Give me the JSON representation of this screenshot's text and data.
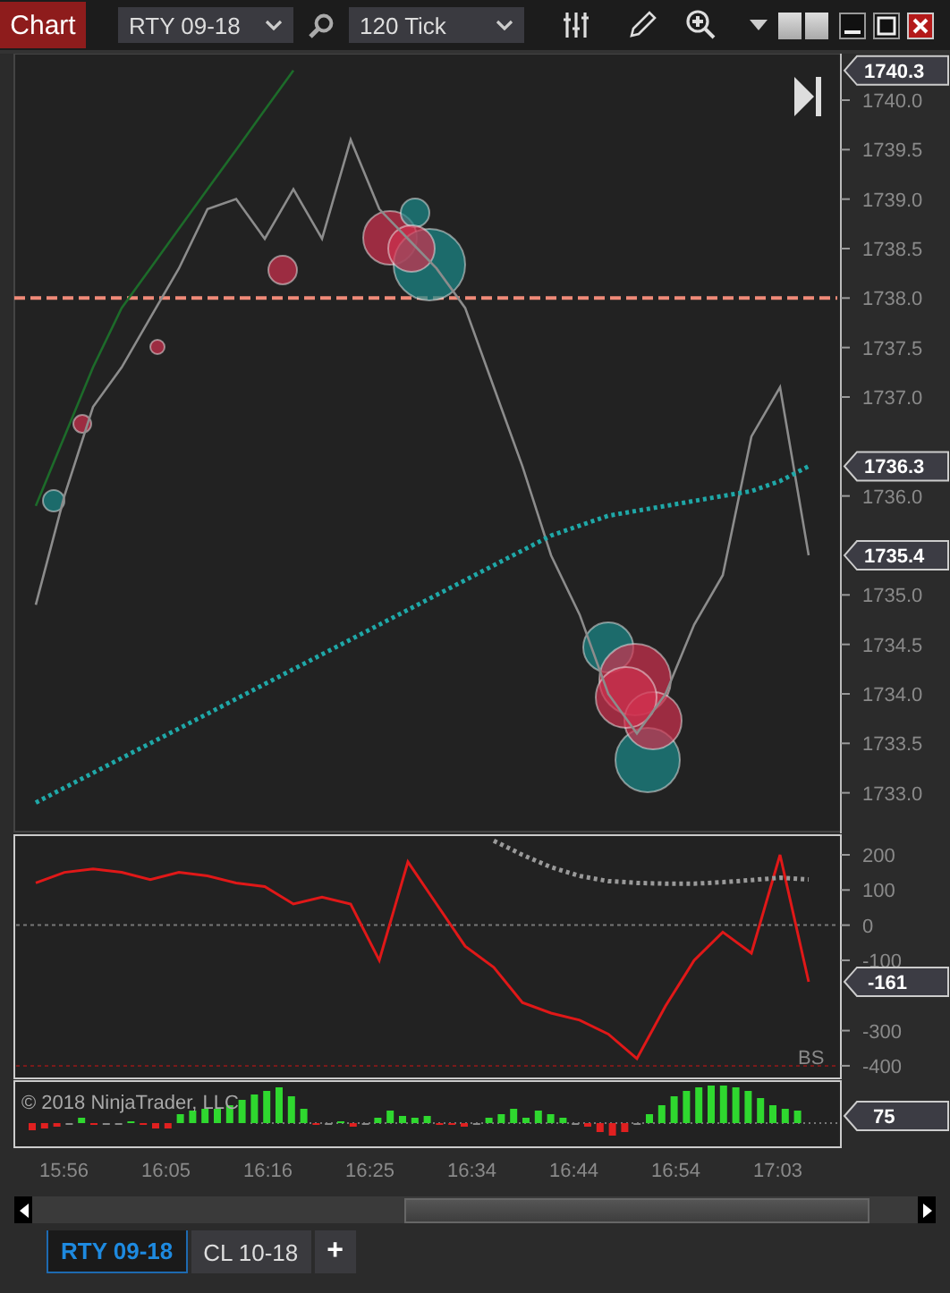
{
  "toolbar": {
    "title": "Chart",
    "instrument": "RTY 09-18",
    "interval": "120 Tick"
  },
  "price_panel": {
    "chart_data": {
      "type": "line",
      "ylim": [
        1732.59,
        1740.47
      ],
      "yticks": [
        {
          "value": 1733,
          "label": "1733.0"
        },
        {
          "value": 1733.5,
          "label": "1733.5"
        },
        {
          "value": 1734,
          "label": "1734.0"
        },
        {
          "value": 1734.5,
          "label": "1734.5"
        },
        {
          "value": 1735,
          "label": "1735.0"
        },
        {
          "value": 1736,
          "label": "1736.0"
        },
        {
          "value": 1737,
          "label": "1737.0"
        },
        {
          "value": 1737.5,
          "label": "1737.5"
        },
        {
          "value": 1738,
          "label": "1738.0"
        },
        {
          "value": 1738.5,
          "label": "1738.5"
        },
        {
          "value": 1739,
          "label": "1739.0"
        },
        {
          "value": 1739.5,
          "label": "1739.5"
        },
        {
          "value": 1740,
          "label": "1740.0"
        }
      ],
      "series": [
        {
          "color": "#8c8c8c",
          "values": [
            1734.9,
            1736.0,
            1736.9,
            1737.3,
            1737.8,
            1738.3,
            1738.9,
            1739.0,
            1738.6,
            1739.1,
            1738.6,
            1739.6,
            1738.9,
            1738.6,
            1738.3,
            1737.9,
            1737.1,
            1736.3,
            1735.4,
            1734.8,
            1734.0,
            1733.6,
            1734.0,
            1734.7,
            1735.2,
            1736.6,
            1737.1,
            1735.4
          ]
        },
        {
          "color": "#1fa8a8",
          "line_style": "dotted",
          "values": [
            1732.9,
            1733.05,
            1733.2,
            1733.35,
            1733.5,
            1733.65,
            1733.8,
            1733.95,
            1734.1,
            1734.25,
            1734.4,
            1734.55,
            1734.7,
            1734.85,
            1735.0,
            1735.15,
            1735.3,
            1735.45,
            1735.6,
            1735.7,
            1735.8,
            1735.85,
            1735.9,
            1735.95,
            1736.0,
            1736.05,
            1736.15,
            1736.3
          ]
        },
        {
          "color": "#1d6b2a",
          "values": [
            1735.9,
            1736.6,
            1737.3,
            1737.9,
            1738.3,
            1738.7,
            1739.1,
            1739.5,
            1739.9,
            1740.3,
            null,
            null,
            null,
            null,
            null,
            null,
            null,
            null,
            null,
            null,
            null,
            null,
            null,
            null,
            null,
            null,
            null,
            null
          ]
        }
      ],
      "ref_lines": [
        {
          "axis": "y",
          "value": 1738,
          "color": "#f08a78",
          "line_style": "dashed"
        }
      ],
      "annotations": [
        "1740.3",
        "1736.3",
        "1735.4"
      ]
    }
  },
  "indicator_panel": {
    "label": "BS",
    "chart_data": {
      "type": "line",
      "ylim": [
        -441,
        261
      ],
      "yticks": [
        200,
        100,
        0,
        -100,
        -300,
        -400
      ],
      "series": [
        {
          "color": "#e01818",
          "values": [
            120,
            150,
            160,
            150,
            130,
            150,
            140,
            120,
            110,
            60,
            80,
            60,
            -100,
            180,
            60,
            -60,
            -120,
            -220,
            -250,
            -270,
            -310,
            -380,
            -230,
            -100,
            -20,
            -80,
            200,
            -161
          ]
        },
        {
          "color": "#9a9a9a",
          "line_style": "dotted",
          "values": [
            null,
            null,
            null,
            null,
            null,
            null,
            null,
            null,
            null,
            null,
            null,
            null,
            null,
            null,
            null,
            null,
            240,
            200,
            165,
            140,
            125,
            120,
            118,
            118,
            122,
            128,
            135,
            130
          ]
        }
      ],
      "ref_lines": [
        {
          "axis": "y",
          "value": 0,
          "color": "#777777",
          "line_style": "dotted"
        },
        {
          "axis": "y",
          "value": -400,
          "color": "#7a1a1a",
          "line_style": "dotted"
        }
      ],
      "annotations": [
        "-161"
      ]
    }
  },
  "histogram_panel": {
    "watermark": "© 2018 NinjaTrader, LLC",
    "flag": "75"
  },
  "time_axis": [
    "15:56",
    "16:05",
    "16:16",
    "16:25",
    "16:34",
    "16:44",
    "16:54",
    "17:03"
  ],
  "tabs": [
    {
      "label": "RTY 09-18",
      "selected": true
    },
    {
      "label": "CL 10-18",
      "selected": false
    }
  ],
  "add_tab": "+"
}
